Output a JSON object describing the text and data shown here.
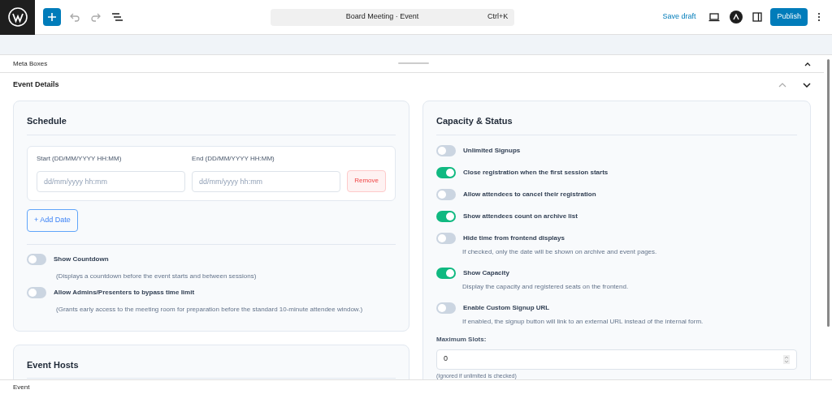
{
  "toolbar": {
    "title": "Board Meeting · Event",
    "shortcut": "Ctrl+K",
    "save_draft": "Save draft",
    "publish": "Publish"
  },
  "meta_boxes": {
    "label": "Meta Boxes"
  },
  "event_details": {
    "label": "Event Details"
  },
  "schedule": {
    "title": "Schedule",
    "start_label": "Start (DD/MM/YYYY HH:MM)",
    "start_placeholder": "dd/mm/yyyy hh:mm",
    "end_label": "End (DD/MM/YYYY HH:MM)",
    "end_placeholder": "dd/mm/yyyy hh:mm",
    "remove": "Remove",
    "add_date": "+ Add Date",
    "toggles": [
      {
        "label": "Show Countdown",
        "on": false,
        "help": "(Displays a countdown before the event starts and between sessions)"
      },
      {
        "label": "Allow Admins/Presenters to bypass time limit",
        "on": false,
        "help": "(Grants early access to the meeting room for preparation before the standard 10-minute attendee window.)"
      }
    ]
  },
  "hosts": {
    "title": "Event Hosts"
  },
  "capacity": {
    "title": "Capacity & Status",
    "toggles": [
      {
        "label": "Unlimited Signups",
        "on": false
      },
      {
        "label": "Close registration when the first session starts",
        "on": true
      },
      {
        "label": "Allow attendees to cancel their registration",
        "on": false
      },
      {
        "label": "Show attendees count on archive list",
        "on": true
      },
      {
        "label": "Hide time from frontend displays",
        "on": false,
        "help": "If checked, only the date will be shown on archive and event pages."
      },
      {
        "label": "Show Capacity",
        "on": true,
        "help": "Display the capacity and registered seats on the frontend."
      },
      {
        "label": "Enable Custom Signup URL",
        "on": false,
        "help": "If enabled, the signup button will link to an external URL instead of the internal form."
      }
    ],
    "max_label": "Maximum Slots:",
    "max_value": "0",
    "max_help": "(Ignored if unlimited is checked)"
  },
  "footer": {
    "breadcrumb": "Event"
  }
}
